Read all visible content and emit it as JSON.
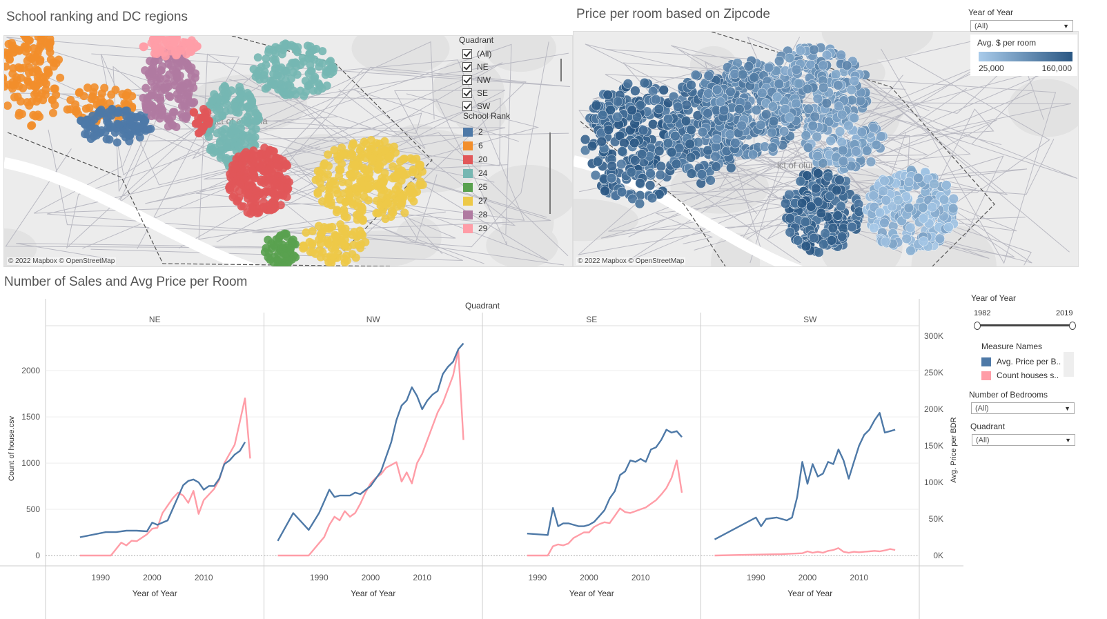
{
  "dashboard": {
    "map1_title": "School ranking and DC regions",
    "map2_title": "Price per room based on Zipcode",
    "chart_title": "Number of Sales and Avg Price per Room",
    "attribution": "© 2022 Mapbox © OpenStreetMap",
    "map_city_label": "ict of\nolumbia"
  },
  "quadrant_filter": {
    "title": "Quadrant",
    "items": [
      "(All)",
      "NE",
      "NW",
      "SE",
      "SW"
    ]
  },
  "school_rank_legend": {
    "title": "School Rank",
    "items": [
      {
        "label": "2",
        "color": "#4e79a7"
      },
      {
        "label": "6",
        "color": "#f28e2b"
      },
      {
        "label": "20",
        "color": "#e15759"
      },
      {
        "label": "24",
        "color": "#76b7b2"
      },
      {
        "label": "25",
        "color": "#59a14f"
      },
      {
        "label": "27",
        "color": "#edc948"
      },
      {
        "label": "28",
        "color": "#b07aa1"
      },
      {
        "label": "29",
        "color": "#ff9da7"
      }
    ]
  },
  "year_filter_top": {
    "title": "Year of Year",
    "value": "(All)"
  },
  "price_legend": {
    "title": "Avg. $ per room",
    "min": "25,000",
    "max": "160,000",
    "color_light": "#a9cbea",
    "color_dark": "#2a5783"
  },
  "year_slider": {
    "title": "Year of Year",
    "min_label": "1982",
    "max_label": "2019"
  },
  "measure_names": {
    "title": "Measure Names",
    "items": [
      {
        "label": "Avg. Price per B..",
        "color": "#4e79a7"
      },
      {
        "label": "Count houses s..",
        "color": "#ff9da7"
      }
    ]
  },
  "bedrooms_filter": {
    "title": "Number of Bedrooms",
    "value": "(All)"
  },
  "quadrant_dropdown": {
    "title": "Quadrant",
    "value": "(All)"
  },
  "chart_data": {
    "type": "line",
    "header": "Quadrant",
    "panels": [
      "NE",
      "NW",
      "SE",
      "SW"
    ],
    "xlabel": "Year of Year",
    "xticks": [
      1990,
      2000,
      2010
    ],
    "xlim": [
      1982,
      2019
    ],
    "ylabel_left": "Count of house.csv",
    "ylim_left": [
      0,
      2300
    ],
    "yticks_left": [
      "0",
      "500",
      "1000",
      "1500",
      "2000"
    ],
    "ylabel_right": "Avg. Price per BDR",
    "ylim_right": [
      0,
      300000
    ],
    "yticks_right": [
      "0K",
      "50K",
      "100K",
      "150K",
      "200K",
      "250K",
      "300K"
    ],
    "series": [
      {
        "name": "Avg. Price per B..",
        "axis": "right",
        "color": "#4e79a7",
        "panels": {
          "NE": [
            [
              1986,
              25000
            ],
            [
              1991,
              32000
            ],
            [
              1993,
              32000
            ],
            [
              1995,
              34000
            ],
            [
              1997,
              34000
            ],
            [
              1999,
              33000
            ],
            [
              2000,
              45000
            ],
            [
              2001,
              42000
            ],
            [
              2003,
              48000
            ],
            [
              2005,
              80000
            ],
            [
              2006,
              96000
            ],
            [
              2007,
              102000
            ],
            [
              2008,
              104000
            ],
            [
              2009,
              100000
            ],
            [
              2010,
              90000
            ],
            [
              2011,
              95000
            ],
            [
              2012,
              95000
            ],
            [
              2013,
              105000
            ],
            [
              2014,
              125000
            ],
            [
              2015,
              130000
            ],
            [
              2016,
              138000
            ],
            [
              2017,
              143000
            ],
            [
              2018,
              155000
            ]
          ],
          "NW": [
            [
              1982,
              20000
            ],
            [
              1985,
              58000
            ],
            [
              1988,
              35000
            ],
            [
              1990,
              58000
            ],
            [
              1992,
              90000
            ],
            [
              1993,
              80000
            ],
            [
              1994,
              82000
            ],
            [
              1996,
              82000
            ],
            [
              1997,
              86000
            ],
            [
              1998,
              84000
            ],
            [
              2000,
              95000
            ],
            [
              2002,
              115000
            ],
            [
              2004,
              155000
            ],
            [
              2005,
              185000
            ],
            [
              2006,
              205000
            ],
            [
              2007,
              212000
            ],
            [
              2008,
              230000
            ],
            [
              2009,
              218000
            ],
            [
              2010,
              200000
            ],
            [
              2011,
              212000
            ],
            [
              2012,
              220000
            ],
            [
              2013,
              225000
            ],
            [
              2014,
              248000
            ],
            [
              2015,
              258000
            ],
            [
              2016,
              265000
            ],
            [
              2017,
              282000
            ],
            [
              2018,
              290000
            ]
          ],
          "SE": [
            [
              1988,
              30000
            ],
            [
              1992,
              28000
            ],
            [
              1993,
              65000
            ],
            [
              1994,
              40000
            ],
            [
              1995,
              44000
            ],
            [
              1996,
              44000
            ],
            [
              1997,
              42000
            ],
            [
              1998,
              40000
            ],
            [
              1999,
              40000
            ],
            [
              2000,
              42000
            ],
            [
              2001,
              46000
            ],
            [
              2002,
              54000
            ],
            [
              2003,
              62000
            ],
            [
              2004,
              78000
            ],
            [
              2005,
              88000
            ],
            [
              2006,
              110000
            ],
            [
              2007,
              115000
            ],
            [
              2008,
              130000
            ],
            [
              2009,
              128000
            ],
            [
              2010,
              132000
            ],
            [
              2011,
              128000
            ],
            [
              2012,
              145000
            ],
            [
              2013,
              148000
            ],
            [
              2014,
              158000
            ],
            [
              2015,
              172000
            ],
            [
              2016,
              168000
            ],
            [
              2017,
              170000
            ],
            [
              2018,
              162000
            ]
          ],
          "SW": [
            [
              1982,
              22000
            ],
            [
              1990,
              52000
            ],
            [
              1991,
              40000
            ],
            [
              1992,
              50000
            ],
            [
              1994,
              52000
            ],
            [
              1996,
              48000
            ],
            [
              1997,
              52000
            ],
            [
              1998,
              80000
            ],
            [
              1999,
              128000
            ],
            [
              2000,
              98000
            ],
            [
              2001,
              125000
            ],
            [
              2002,
              108000
            ],
            [
              2003,
              112000
            ],
            [
              2004,
              128000
            ],
            [
              2005,
              125000
            ],
            [
              2006,
              145000
            ],
            [
              2007,
              130000
            ],
            [
              2008,
              105000
            ],
            [
              2009,
              128000
            ],
            [
              2010,
              150000
            ],
            [
              2011,
              165000
            ],
            [
              2012,
              172000
            ],
            [
              2013,
              185000
            ],
            [
              2014,
              195000
            ],
            [
              2015,
              168000
            ],
            [
              2016,
              170000
            ],
            [
              2017,
              172000
            ]
          ]
        }
      },
      {
        "name": "Count houses s..",
        "axis": "left",
        "color": "#ff9da7",
        "panels": {
          "NE": [
            [
              1986,
              0
            ],
            [
              1992,
              0
            ],
            [
              1994,
              140
            ],
            [
              1995,
              110
            ],
            [
              1996,
              160
            ],
            [
              1997,
              155
            ],
            [
              1999,
              230
            ],
            [
              2000,
              290
            ],
            [
              2001,
              300
            ],
            [
              2002,
              460
            ],
            [
              2003,
              540
            ],
            [
              2004,
              620
            ],
            [
              2005,
              680
            ],
            [
              2006,
              650
            ],
            [
              2007,
              570
            ],
            [
              2008,
              700
            ],
            [
              2009,
              450
            ],
            [
              2010,
              600
            ],
            [
              2012,
              720
            ],
            [
              2013,
              820
            ],
            [
              2014,
              1000
            ],
            [
              2015,
              1100
            ],
            [
              2016,
              1200
            ],
            [
              2017,
              1450
            ],
            [
              2018,
              1700
            ],
            [
              2019,
              1050
            ]
          ],
          "NW": [
            [
              1982,
              0
            ],
            [
              1988,
              0
            ],
            [
              1991,
              200
            ],
            [
              1992,
              330
            ],
            [
              1993,
              420
            ],
            [
              1994,
              380
            ],
            [
              1995,
              480
            ],
            [
              1996,
              420
            ],
            [
              1997,
              460
            ],
            [
              1998,
              560
            ],
            [
              1999,
              680
            ],
            [
              2000,
              780
            ],
            [
              2001,
              840
            ],
            [
              2002,
              880
            ],
            [
              2003,
              950
            ],
            [
              2004,
              980
            ],
            [
              2005,
              1010
            ],
            [
              2006,
              800
            ],
            [
              2007,
              900
            ],
            [
              2008,
              780
            ],
            [
              2009,
              1000
            ],
            [
              2010,
              1100
            ],
            [
              2011,
              1250
            ],
            [
              2012,
              1400
            ],
            [
              2013,
              1550
            ],
            [
              2014,
              1650
            ],
            [
              2015,
              1800
            ],
            [
              2016,
              1950
            ],
            [
              2017,
              2220
            ],
            [
              2018,
              1250
            ]
          ],
          "SE": [
            [
              1988,
              0
            ],
            [
              1992,
              0
            ],
            [
              1993,
              100
            ],
            [
              1994,
              120
            ],
            [
              1995,
              110
            ],
            [
              1996,
              130
            ],
            [
              1997,
              190
            ],
            [
              1998,
              220
            ],
            [
              1999,
              250
            ],
            [
              2000,
              250
            ],
            [
              2001,
              310
            ],
            [
              2002,
              340
            ],
            [
              2003,
              360
            ],
            [
              2004,
              350
            ],
            [
              2005,
              430
            ],
            [
              2006,
              510
            ],
            [
              2007,
              470
            ],
            [
              2008,
              460
            ],
            [
              2009,
              480
            ],
            [
              2010,
              500
            ],
            [
              2011,
              520
            ],
            [
              2012,
              560
            ],
            [
              2013,
              600
            ],
            [
              2014,
              660
            ],
            [
              2015,
              730
            ],
            [
              2016,
              840
            ],
            [
              2017,
              1030
            ],
            [
              2018,
              680
            ]
          ],
          "SW": [
            [
              1982,
              0
            ],
            [
              1990,
              10
            ],
            [
              1995,
              15
            ],
            [
              1997,
              20
            ],
            [
              1999,
              25
            ],
            [
              2000,
              45
            ],
            [
              2001,
              30
            ],
            [
              2002,
              40
            ],
            [
              2003,
              30
            ],
            [
              2004,
              50
            ],
            [
              2005,
              60
            ],
            [
              2006,
              80
            ],
            [
              2007,
              40
            ],
            [
              2008,
              30
            ],
            [
              2009,
              40
            ],
            [
              2010,
              35
            ],
            [
              2011,
              40
            ],
            [
              2012,
              45
            ],
            [
              2013,
              50
            ],
            [
              2014,
              45
            ],
            [
              2015,
              55
            ],
            [
              2016,
              70
            ],
            [
              2017,
              60
            ]
          ]
        }
      }
    ]
  }
}
